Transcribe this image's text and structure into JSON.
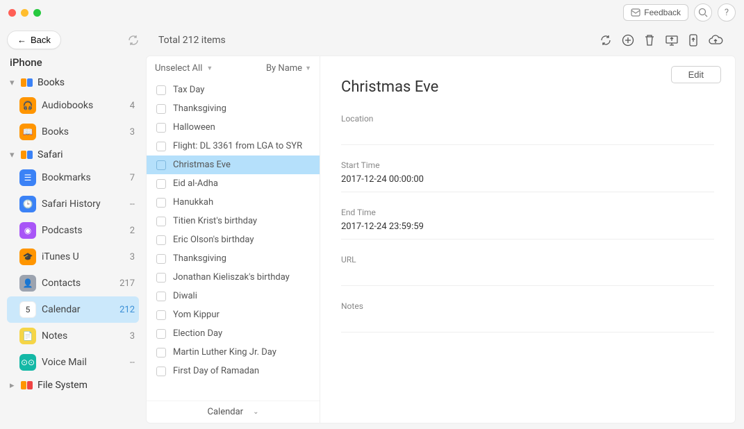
{
  "titlebar": {
    "feedback": "Feedback"
  },
  "back_label": "Back",
  "device_name": "iPhone",
  "sidebar": {
    "groups": [
      {
        "label": "Books",
        "expanded": true,
        "icon": "books-pair",
        "items": [
          {
            "label": "Audiobooks",
            "count": "4",
            "icon": "orange",
            "glyph": "🎧"
          },
          {
            "label": "Books",
            "count": "3",
            "icon": "orange",
            "glyph": "📖"
          }
        ]
      },
      {
        "label": "Safari",
        "expanded": true,
        "icon": "safari-pair",
        "items": [
          {
            "label": "Bookmarks",
            "count": "7",
            "icon": "blue",
            "glyph": "☰"
          },
          {
            "label": "Safari History",
            "count": "--",
            "icon": "blue",
            "glyph": "🕒"
          }
        ]
      }
    ],
    "flat": [
      {
        "label": "Podcasts",
        "count": "2",
        "icon": "purple",
        "glyph": "◉"
      },
      {
        "label": "iTunes U",
        "count": "3",
        "icon": "orange",
        "glyph": "🎓"
      },
      {
        "label": "Contacts",
        "count": "217",
        "icon": "grey",
        "glyph": "👤"
      },
      {
        "label": "Calendar",
        "count": "212",
        "icon": "white",
        "glyph": "5",
        "selected": true
      },
      {
        "label": "Notes",
        "count": "3",
        "icon": "yellow",
        "glyph": "📄"
      },
      {
        "label": "Voice Mail",
        "count": "--",
        "icon": "teal",
        "glyph": "⊙⊙"
      }
    ],
    "filesystem": {
      "label": "File System"
    }
  },
  "main": {
    "total": "Total 212 items",
    "select_all": "Unselect All",
    "sort": "By Name",
    "footer": "Calendar",
    "edit": "Edit"
  },
  "items": [
    {
      "label": "Tax Day"
    },
    {
      "label": "Thanksgiving"
    },
    {
      "label": "Halloween"
    },
    {
      "label": "Flight: DL 3361 from LGA to SYR"
    },
    {
      "label": "Christmas Eve",
      "selected": true
    },
    {
      "label": "Eid al-Adha"
    },
    {
      "label": "Hanukkah"
    },
    {
      "label": "Titien Krist's birthday"
    },
    {
      "label": "Eric Olson's birthday"
    },
    {
      "label": "Thanksgiving"
    },
    {
      "label": "Jonathan Kieliszak's birthday"
    },
    {
      "label": "Diwali"
    },
    {
      "label": "Yom Kippur"
    },
    {
      "label": "Election Day"
    },
    {
      "label": "Martin Luther King Jr. Day"
    },
    {
      "label": "First Day of Ramadan"
    }
  ],
  "detail": {
    "title": "Christmas Eve",
    "fields": [
      {
        "k": "Location",
        "v": ""
      },
      {
        "k": "Start Time",
        "v": "2017-12-24 00:00:00"
      },
      {
        "k": "End Time",
        "v": "2017-12-24 23:59:59"
      },
      {
        "k": "URL",
        "v": ""
      },
      {
        "k": "Notes",
        "v": ""
      }
    ]
  }
}
